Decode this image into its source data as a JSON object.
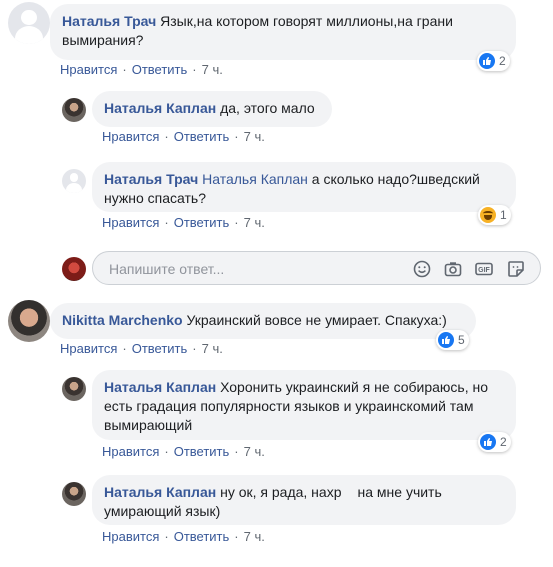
{
  "comments": [
    {
      "author": "Наталья Трач",
      "text_1": "Язык,на котором говорят миллионы,на грани",
      "text_2": "вымирания?",
      "like_label": "Нравится",
      "reply_label": "Ответить",
      "time": "7 ч.",
      "reaction_count": "2",
      "replies": [
        {
          "author": "Наталья Каплан",
          "text": "да, этого мало",
          "like_label": "Нравится",
          "reply_label": "Ответить",
          "time": "7 ч."
        },
        {
          "author": "Наталья Трач",
          "mention": "Наталья Каплан",
          "text_1": "а сколько надо?шведский",
          "text_2": "нужно спасать?",
          "like_label": "Нравится",
          "reply_label": "Ответить",
          "time": "7 ч.",
          "reaction_count": "1"
        }
      ],
      "reply_input": {
        "placeholder": "Напишите ответ..."
      }
    },
    {
      "author": "Nikitta Marchenko",
      "text": "Украинский вовсе не умирает. Спакуха:)",
      "like_label": "Нравится",
      "reply_label": "Ответить",
      "time": "7 ч.",
      "reaction_count": "5",
      "replies": [
        {
          "author": "Наталья Каплан",
          "text_1": "Хоронить украинский я не собираюсь, но",
          "text_2": "есть градация популярности языков и украинскомий там",
          "text_3": "вымирающий",
          "like_label": "Нравится",
          "reply_label": "Ответить",
          "time": "7 ч.",
          "reaction_count": "2"
        },
        {
          "author": "Наталья Каплан",
          "text_1": "ну ок, я рада, нахр",
          "text_1b": "на мне учить",
          "text_2": "умирающий язык)",
          "like_label": "Нравится",
          "reply_label": "Ответить",
          "time": "7 ч."
        }
      ]
    }
  ],
  "icons": {
    "emoji": "emoji-icon",
    "camera": "camera-icon",
    "gif": "gif-icon",
    "sticker": "sticker-icon",
    "like": "like-reaction-icon",
    "haha": "haha-reaction-icon"
  },
  "colors": {
    "link": "#385898",
    "bubble": "#f2f3f5",
    "like_blue": "#1877f2",
    "meta": "#606770"
  }
}
